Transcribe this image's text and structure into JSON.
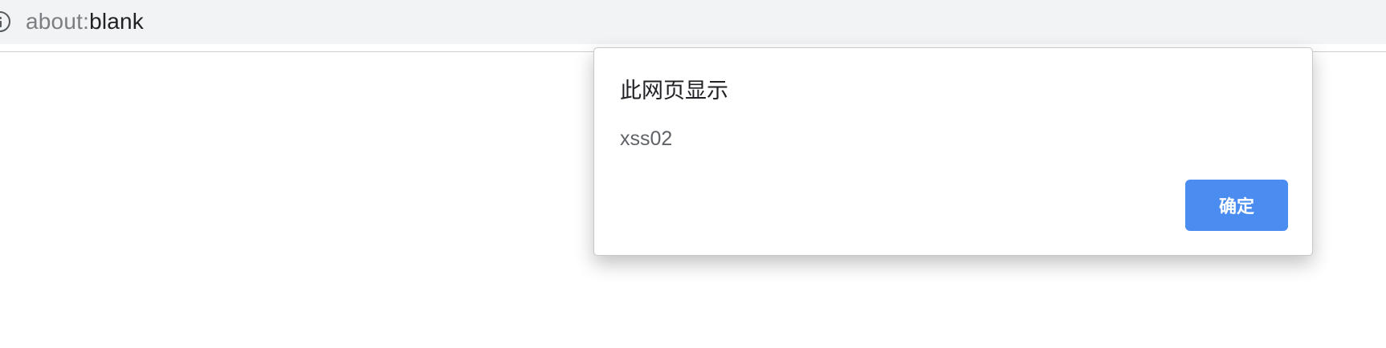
{
  "address_bar": {
    "info_icon": "info-icon",
    "url_scheme": "about:",
    "url_rest": "blank"
  },
  "dialog": {
    "title": "此网页显示",
    "message": "xss02",
    "ok_label": "确定",
    "ok_color": "#4a8cf0"
  }
}
